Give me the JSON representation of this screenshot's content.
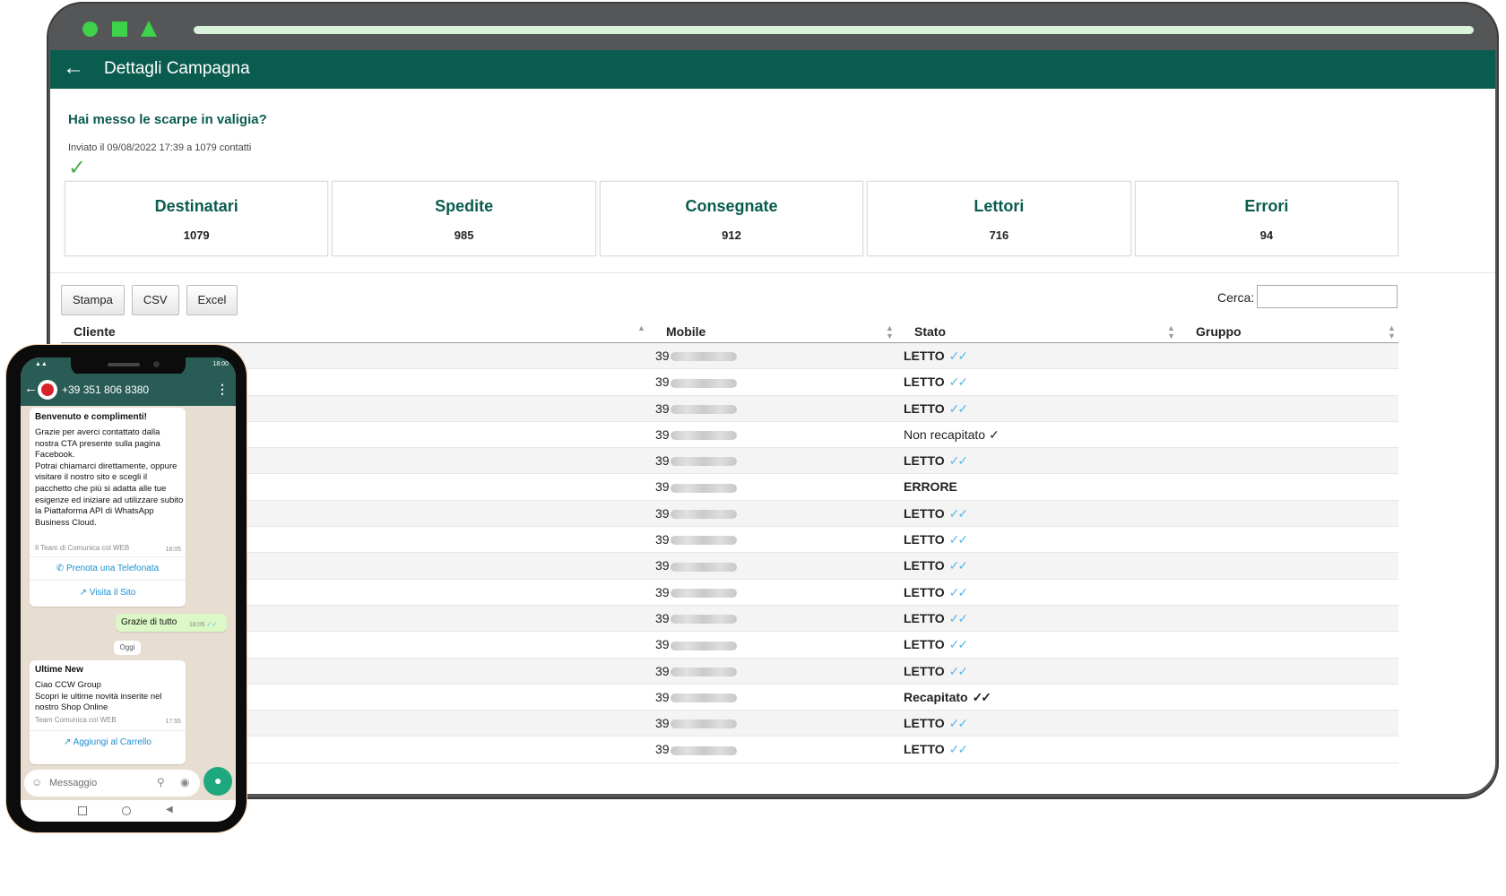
{
  "app": {
    "title": "Dettagli Campagna",
    "accent": "#0a5c4f",
    "browser_shape_color": "#3ed14a"
  },
  "campaign": {
    "title": "Hai messo le scarpe in valigia?",
    "subtitle": "Inviato il 09/08/2022 17:39 a 1079 contatti",
    "status_icon": "check-icon"
  },
  "stats": [
    {
      "label": "Destinatari",
      "value": "1079"
    },
    {
      "label": "Spedite",
      "value": "985"
    },
    {
      "label": "Consegnate",
      "value": "912"
    },
    {
      "label": "Lettori",
      "value": "716"
    },
    {
      "label": "Errori",
      "value": "94"
    }
  ],
  "toolbar": {
    "print_label": "Stampa",
    "csv_label": "CSV",
    "excel_label": "Excel",
    "search_label": "Cerca:",
    "search_value": ""
  },
  "table": {
    "columns": [
      "Cliente",
      "Mobile",
      "Stato",
      "Gruppo"
    ],
    "rows": [
      {
        "mobile": "39",
        "status": "LETTO",
        "status_icon": "double-check-blue"
      },
      {
        "mobile": "39",
        "status": "LETTO",
        "status_icon": "double-check-blue"
      },
      {
        "mobile": "39",
        "status": "LETTO",
        "status_icon": "double-check-blue"
      },
      {
        "mobile": "39",
        "status": "Non recapitato",
        "status_icon": "single-check"
      },
      {
        "mobile": "39",
        "status": "LETTO",
        "status_icon": "double-check-blue"
      },
      {
        "mobile": "39",
        "status": "ERRORE",
        "status_icon": "none"
      },
      {
        "mobile": "39",
        "status": "LETTO",
        "status_icon": "double-check-blue"
      },
      {
        "mobile": "39",
        "status": "LETTO",
        "status_icon": "double-check-blue"
      },
      {
        "mobile": "39",
        "status": "LETTO",
        "status_icon": "double-check-blue"
      },
      {
        "mobile": "39",
        "status": "LETTO",
        "status_icon": "double-check-blue"
      },
      {
        "mobile": "39",
        "status": "LETTO",
        "status_icon": "double-check-blue"
      },
      {
        "mobile": "39",
        "status": "LETTO",
        "status_icon": "double-check-blue"
      },
      {
        "mobile": "39",
        "status": "LETTO",
        "status_icon": "double-check-blue"
      },
      {
        "mobile": "39",
        "status": "Recapitato",
        "status_icon": "double-check-dark"
      },
      {
        "mobile": "39",
        "status": "LETTO",
        "status_icon": "double-check-blue"
      },
      {
        "mobile": "39",
        "status": "LETTO",
        "status_icon": "double-check-blue"
      }
    ]
  },
  "phone": {
    "status_time": "18:00",
    "contact_name": "+39 351 806 8380",
    "messages": [
      {
        "title": "Benvenuto e complimenti!",
        "body": "Grazie per averci contattato dalla nostra CTA presente sulla pagina Facebook.\nPotrai chiamarci direttamente, oppure visitare il nostro sito e scegli il pacchetto che più si adatta alle tue esigenze ed iniziare ad utilizzare subito la Piattaforma API di WhatsApp Business Cloud.",
        "footer": "Il Team di Comunica col WEB",
        "time": "18:05",
        "buttons": [
          "Prenota una Telefonata",
          "Visita il Sito"
        ]
      },
      {
        "text": "Grazie di tutto",
        "time": "18:05"
      },
      {
        "day": "Oggi"
      },
      {
        "title": "Ultime New",
        "body": "Ciao CCW Group\nScopri le ultime novità inserite nel nostro Shop Online",
        "footer": "Team Comunica col WEB",
        "time": "17:55",
        "buttons": [
          "Aggiungi al Carrello"
        ]
      }
    ],
    "input_placeholder": "Messaggio"
  }
}
